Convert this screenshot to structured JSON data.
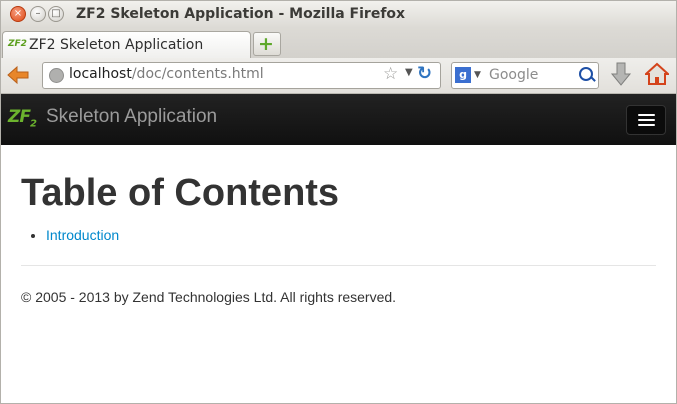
{
  "window": {
    "title": "ZF2 Skeleton Application - Mozilla Firefox",
    "controls": {
      "close": "×",
      "minimize": "–",
      "maximize": "□"
    }
  },
  "tabs": [
    {
      "label": "ZF2 Skeleton Application",
      "favicon": "ZF2",
      "active": true
    }
  ],
  "new_tab_symbol": "+",
  "navbar": {
    "url_host": "localhost",
    "url_path": "/doc/contents.html",
    "search_placeholder": "Google",
    "search_engine_letter": "g"
  },
  "site": {
    "logo_text": "ZF",
    "logo_sub": "2",
    "brand": "Skeleton Application"
  },
  "content": {
    "title": "Table of Contents",
    "toc": [
      {
        "label": "Introduction"
      }
    ],
    "footer": "© 2005 - 2013 by Zend Technologies Ltd. All rights reserved."
  },
  "colors": {
    "link": "#0088cc",
    "navbar_bg": "#1b1b1b",
    "logo_green": "#6cb32e",
    "firefox_orange": "#e4781c"
  },
  "icons": [
    "close-icon",
    "minimize-icon",
    "maximize-icon",
    "zf2-favicon",
    "plus-icon",
    "back-arrow-icon",
    "globe-icon",
    "bookmark-star-icon",
    "dropdown-icon",
    "reload-icon",
    "google-icon",
    "search-icon",
    "download-icon",
    "home-icon",
    "hamburger-menu-icon"
  ]
}
